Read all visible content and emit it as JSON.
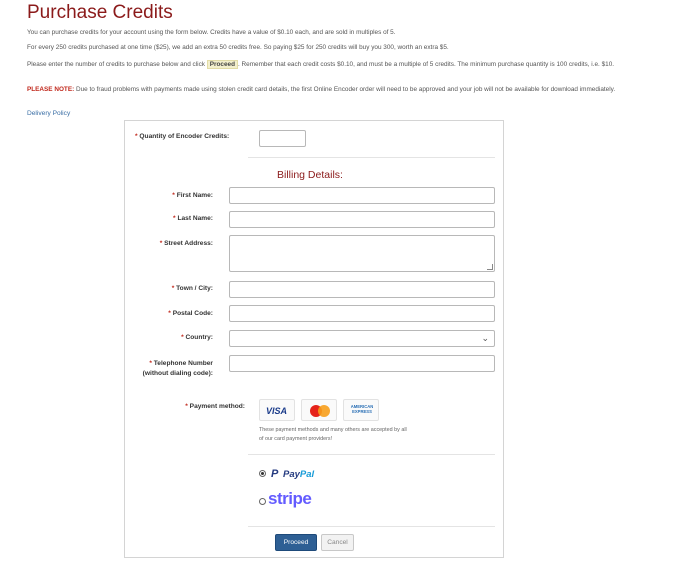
{
  "page": {
    "title": "Purchase Credits",
    "para1": "You can purchase credits for your account using the form below. Credits have a value of $0.10 each, and are sold in multiples of 5.",
    "para2": "For every 250 credits purchased at one time ($25), we add an extra 50 credits free. So paying $25 for 250 credits will buy you 300, worth an extra $5.",
    "para3_before": "Please enter the number of credits to purchase below and click ",
    "para3_chip": "Proceed",
    "para3_after": ". Remember that each credit costs $0.10, and must be a multiple of 5 credits. The minimum purchase quantity is 100 credits, i.e. $10.",
    "note_label": "PLEASE NOTE:",
    "note_text": " Due to fraud problems with payments made using stolen credit card details, the first Online Encoder order will need to be approved and your job will not be available for download immediately.",
    "delivery_link": "Delivery Policy"
  },
  "form": {
    "required_mark": "*",
    "quantity_label": "Quantity of Encoder Credits:",
    "quantity_value": "",
    "billing_heading": "Billing Details:",
    "first_name_label": "First Name:",
    "last_name_label": "Last Name:",
    "street_label": "Street Address:",
    "town_label": "Town / City:",
    "postal_label": "Postal Code:",
    "country_label": "Country:",
    "country_value": "",
    "telephone_label_line1": "Telephone Number",
    "telephone_label_line2": "(without dialing code):",
    "payment_label": "Payment method:",
    "cards": {
      "visa": "VISA",
      "amex": "AMERICAN EXPRESS"
    },
    "payment_note": "These payment methods and many others are accepted by all of our card payment providers!",
    "paypal_pay": "Pay",
    "paypal_pal": "Pal",
    "stripe": "stripe",
    "selected_provider": "paypal",
    "proceed_button": "Proceed",
    "cancel_button": "Cancel"
  },
  "colors": {
    "title": "#8b1a1a",
    "required": "#c0271b",
    "link": "#3a6ea5",
    "primary_button": "#2e5f94",
    "stripe": "#635bff",
    "paypal_dark": "#253b80",
    "paypal_light": "#179bd7"
  },
  "icons": {
    "country_dropdown": "chevron-down-icon",
    "visa": "visa-card-icon",
    "mastercard": "mastercard-icon",
    "amex": "amex-card-icon",
    "paypal": "paypal-logo-icon",
    "stripe": "stripe-logo-icon"
  }
}
